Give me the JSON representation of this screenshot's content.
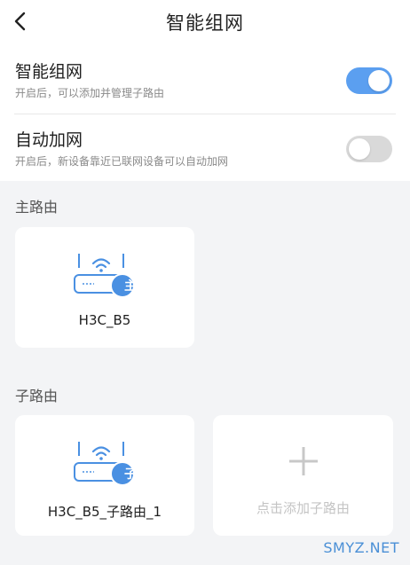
{
  "header": {
    "title": "智能组网"
  },
  "settings": [
    {
      "title": "智能组网",
      "desc": "开启后，可以添加并管理子路由",
      "enabled": true
    },
    {
      "title": "自动加网",
      "desc": "开启后，新设备靠近已联网设备可以自动加网",
      "enabled": false
    }
  ],
  "main_router": {
    "section_label": "主路由",
    "device": {
      "name": "H3C_B5",
      "badge": "主"
    }
  },
  "sub_router": {
    "section_label": "子路由",
    "devices": [
      {
        "name": "H3C_B5_子路由_1",
        "badge": "子"
      }
    ],
    "add_label": "点击添加子路由"
  },
  "watermark": "SMYZ.NET",
  "colors": {
    "accent": "#5b9ff0",
    "toggle_off": "#d9d9d9",
    "background": "#f3f4f6"
  }
}
